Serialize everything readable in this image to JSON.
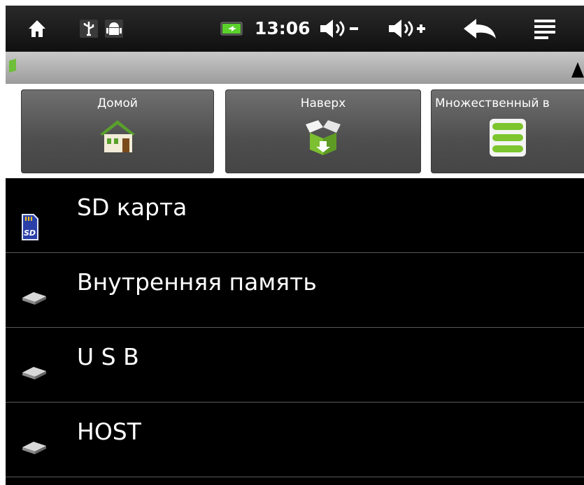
{
  "status_bar": {
    "time": "13:06"
  },
  "toolbar": {
    "buttons": [
      {
        "label": "Домой",
        "icon": "home-icon"
      },
      {
        "label": "Наверх",
        "icon": "up-icon"
      },
      {
        "label": "Множественный в",
        "icon": "multi-select-icon"
      }
    ]
  },
  "locations": [
    {
      "label": "SD карта",
      "icon": "sd-card-icon"
    },
    {
      "label": "Внутренняя память",
      "icon": "drive-icon"
    },
    {
      "label": "U S B",
      "icon": "drive-icon"
    },
    {
      "label": "HOST",
      "icon": "drive-icon"
    }
  ],
  "colors": {
    "status_bar": "#1a1a1a",
    "battery": "#5bd12c",
    "toolbar_button": "#555555",
    "list_background": "#000000"
  }
}
